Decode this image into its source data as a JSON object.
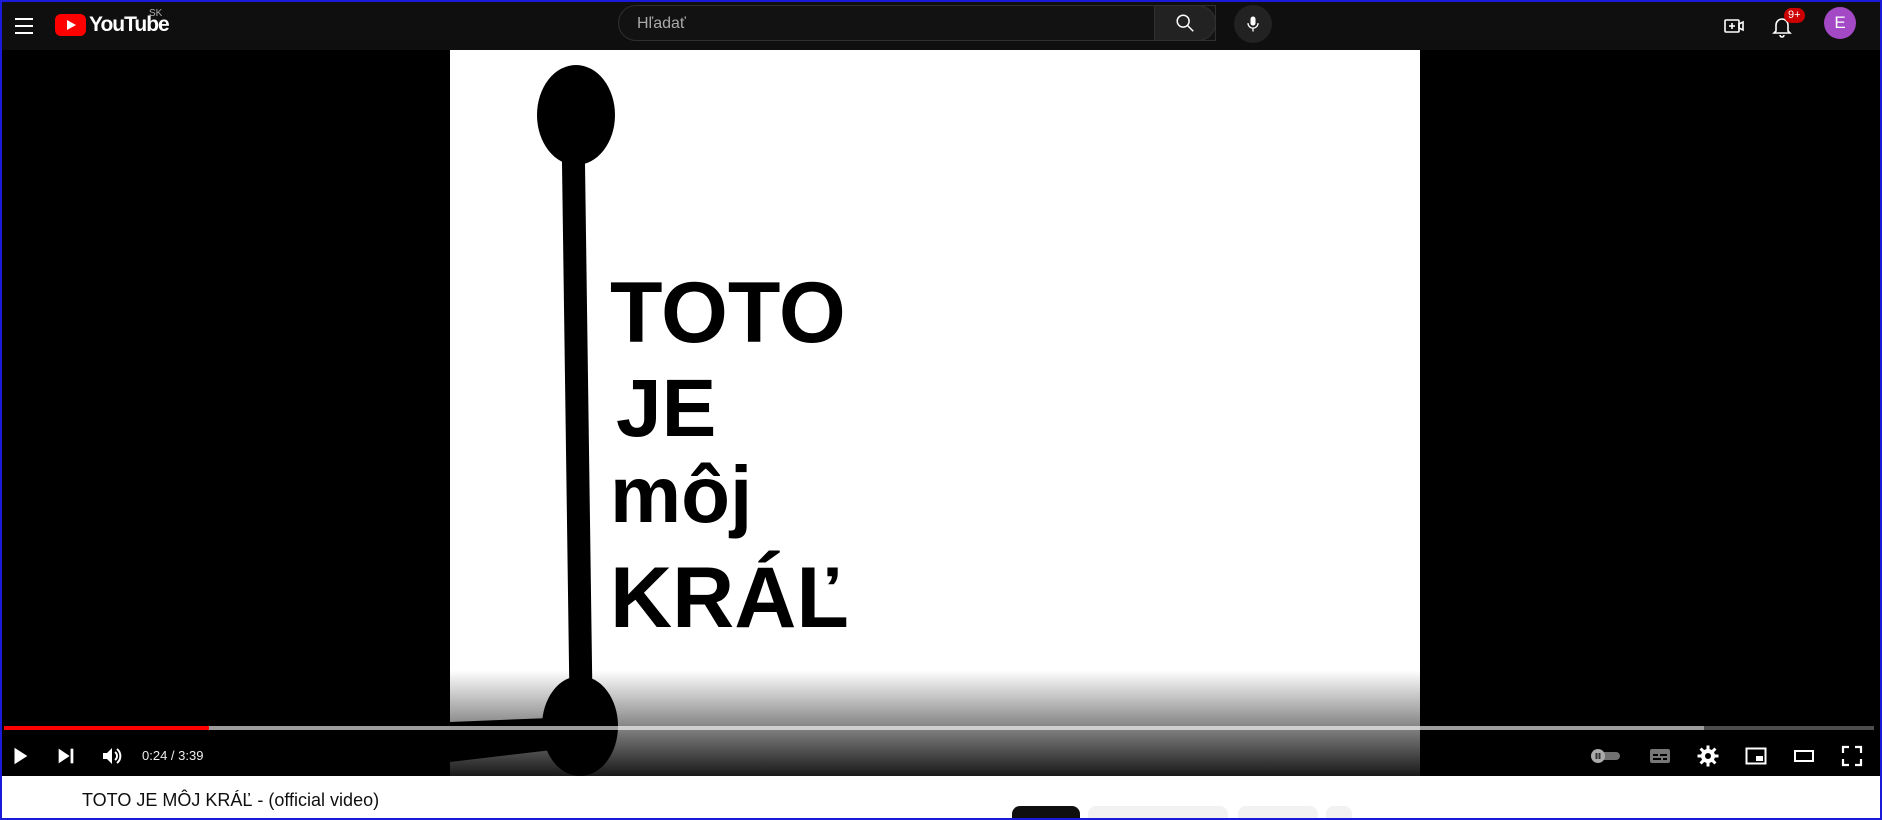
{
  "header": {
    "logo_text": "YouTube",
    "country_code": "SK",
    "search_placeholder": "Hľadať",
    "notification_count": "9+",
    "avatar_letter": "E"
  },
  "video": {
    "frame_lines": [
      "TOTO",
      "JE",
      "môj",
      "KRÁĽ"
    ],
    "time_display": "0:24 / 3:39",
    "progress_fraction": 0.1096,
    "buffered_fraction": 0.909
  },
  "below": {
    "title": "TOTO JE MÔJ KRÁĽ - (official video)"
  },
  "colors": {
    "accent": "#ff0000",
    "avatar_bg": "#a349c5",
    "background": "#0f0f0f"
  }
}
